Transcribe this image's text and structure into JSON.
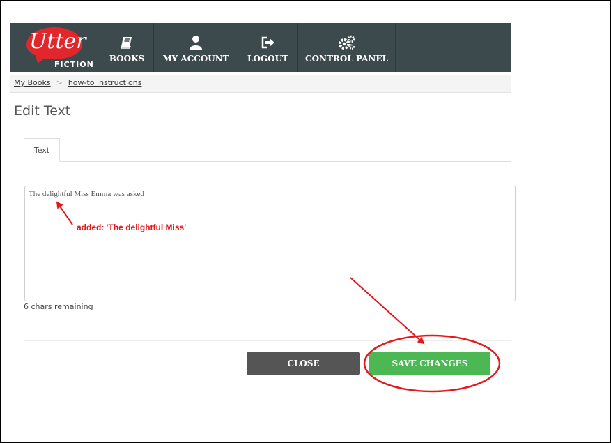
{
  "logo": {
    "name": "Utter",
    "sub": "FICTION"
  },
  "nav": {
    "items": [
      {
        "label": "BOOKS",
        "icon": "book-icon"
      },
      {
        "label": "MY ACCOUNT",
        "icon": "user-icon"
      },
      {
        "label": "LOGOUT",
        "icon": "logout-icon"
      },
      {
        "label": "CONTROL PANEL",
        "icon": "gears-icon"
      }
    ]
  },
  "breadcrumb": {
    "items": [
      "My Books",
      "how-to instructions"
    ],
    "separator": ">"
  },
  "page": {
    "title": "Edit Text"
  },
  "tabs": [
    {
      "label": "Text"
    }
  ],
  "editor": {
    "value": "The delightful Miss Emma was asked"
  },
  "chars_remaining": "6 chars remaining",
  "buttons": {
    "close": "CLOSE",
    "save": "SAVE CHANGES"
  },
  "annotation": {
    "text": "added: 'The delightful Miss'"
  },
  "colors": {
    "navbar": "#3c4a4e",
    "logo_red": "#e3262c",
    "save_green": "#4cb853",
    "close_gray": "#555555",
    "annotation_red": "#e3191b"
  }
}
